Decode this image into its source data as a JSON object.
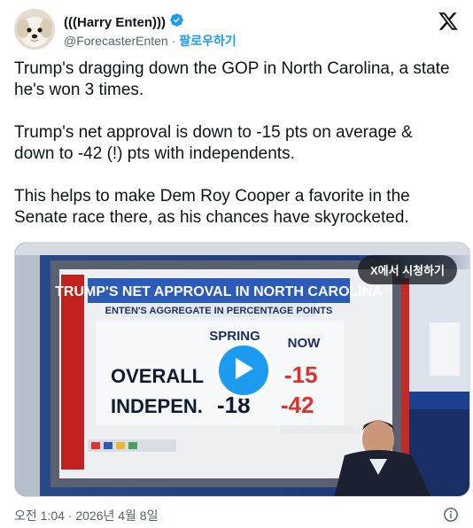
{
  "author": {
    "name": "(((Harry Enten)))",
    "handle": "@ForecasterEnten",
    "separator": "·",
    "follow_label": "팔로우하기"
  },
  "tweet": {
    "paragraphs": [
      "Trump's dragging down the GOP in North Carolina, a state he's won 3 times.",
      "Trump's net approval is down to -15 pts on average & down to -42 (!) pts with independents.",
      "This helps to make Dem Roy Cooper a favorite in the Senate race there, as his chances have skyrocketed."
    ]
  },
  "media": {
    "watch_label": "X에서 시청하기",
    "screen": {
      "headline": "TRUMP'S NET APPROVAL IN NORTH CAROLINA",
      "subhead": "ENTEN'S AGGREGATE IN PERCENTAGE POINTS",
      "col_spring": "SPRING",
      "col_now": "NOW",
      "row1_label": "OVERALL",
      "row1_now": "-15",
      "row2_label": "INDEPEN.",
      "row2_spring": "-18",
      "row2_now": "-42"
    }
  },
  "timestamp": "오전 1:04 · 2026년 4월 8일",
  "icons": {
    "verified": "verified-badge-icon",
    "x_logo": "x-logo-icon",
    "play": "play-icon",
    "info": "info-icon"
  },
  "colors": {
    "accent": "#1d9bf0",
    "text": "#0f1419",
    "muted": "#536471",
    "chart_red": "#e0312e"
  }
}
